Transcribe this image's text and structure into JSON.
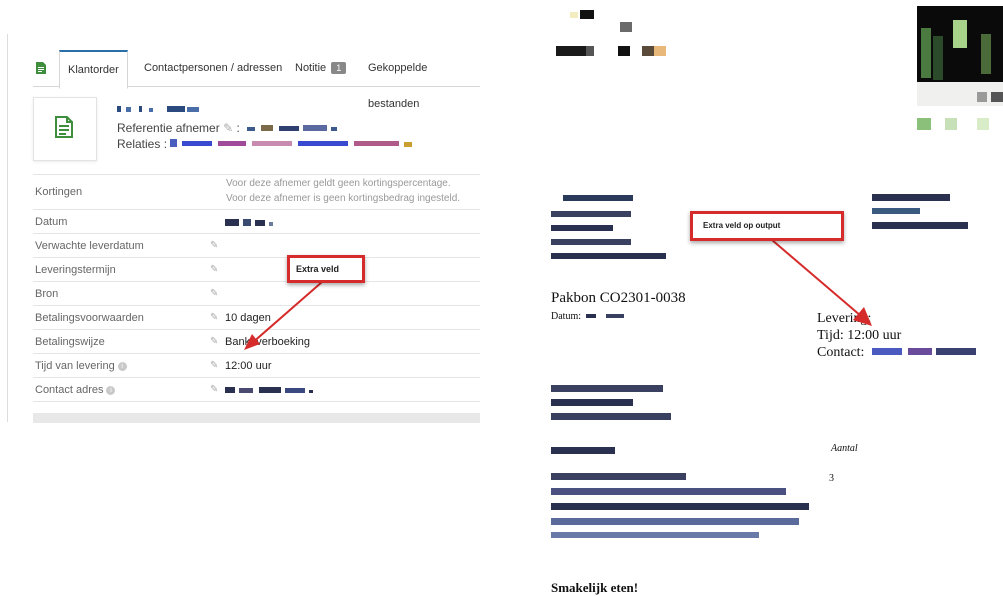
{
  "tabs": [
    {
      "label": "Klantorder"
    },
    {
      "label": "Contactpersonen / adressen"
    },
    {
      "label": "Notitie"
    },
    {
      "label": "Gekoppelde bestanden"
    }
  ],
  "notes_badge": "1",
  "header": {
    "referentie_label": "Referentie afnemer",
    "relaties_label": "Relaties :"
  },
  "details": {
    "kortingen_label": "Kortingen",
    "kortingen_note_1": "Voor deze afnemer geldt geen kortingspercentage.",
    "kortingen_note_2": "Voor deze afnemer is geen kortingsbedrag ingesteld.",
    "datum_label": "Datum",
    "verwachte_leverdatum_label": "Verwachte leverdatum",
    "leveringstermijn_label": "Leveringstermijn",
    "bron_label": "Bron",
    "betalingsvoorwaarden_label": "Betalingsvoorwaarden",
    "betalingsvoorwaarden_value": "10 dagen",
    "betalingswijze_label": "Betalingswijze",
    "betalingswijze_value": "Bankoverboeking",
    "tijd_label": "Tijd van levering",
    "tijd_value": "12:00 uur",
    "contact_adres_label": "Contact adres"
  },
  "callouts": {
    "left": "Extra veld",
    "right": "Extra veld op output"
  },
  "pakbon": {
    "title": "Pakbon CO2301-0038",
    "datum_label": "Datum:",
    "levering_label": "Levering:",
    "tijd_text": "Tijd: 12:00 uur",
    "contact_label": "Contact:",
    "aantal_header": "Aantal",
    "quantity": "3",
    "closing": "Smakelijk eten!"
  },
  "colors": {
    "accent": "#2a6fa8",
    "callout_border": "#d62b2b",
    "doc_icon": "#3e8e3e"
  }
}
